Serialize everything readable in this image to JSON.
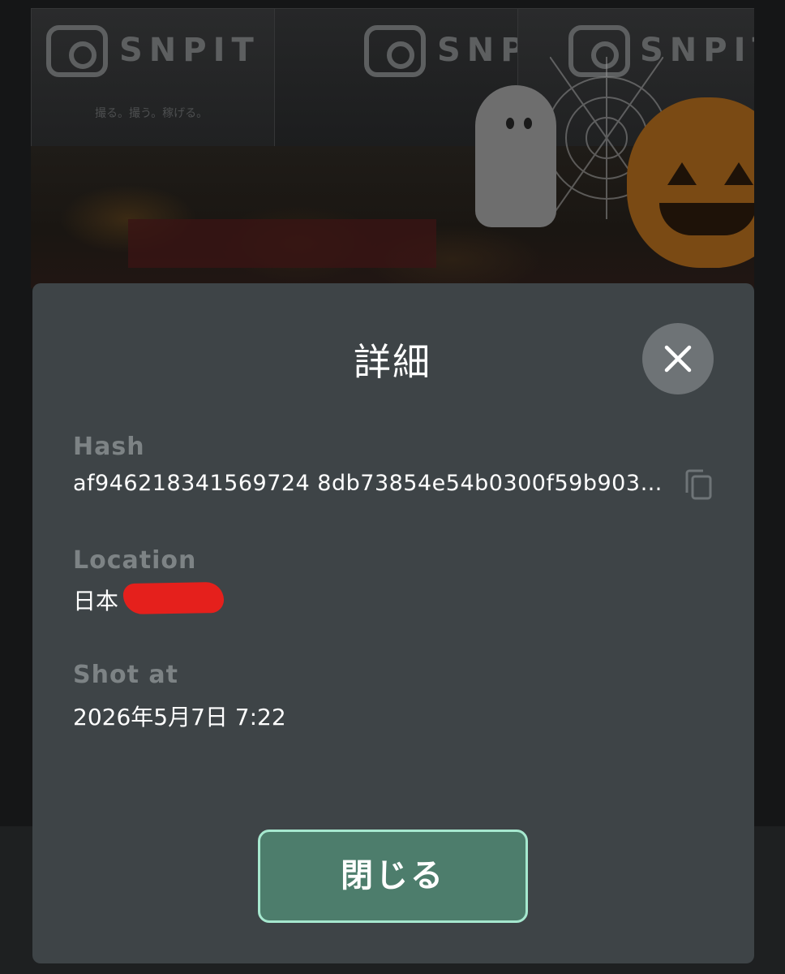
{
  "background": {
    "brand_text": "SNPIT",
    "tagline": "撮る。撮う。稼げる。"
  },
  "modal": {
    "title": "詳細",
    "fields": {
      "hash": {
        "label": "Hash",
        "value": "af946218341569724 8db73854e54b0300f59b9031..."
      },
      "location": {
        "label": "Location",
        "value": "日本"
      },
      "shot_at": {
        "label": "Shot at",
        "value": "2026年5月7日 7:22"
      }
    },
    "close_button_label": "閉じる"
  },
  "icons": {
    "close": "close-icon",
    "copy": "copy-icon"
  },
  "colors": {
    "modal_bg": "#3e4447",
    "label": "#7d8385",
    "button_bg": "#4d7d6c",
    "button_border": "#a6e8cf",
    "redaction": "#e5201c"
  }
}
